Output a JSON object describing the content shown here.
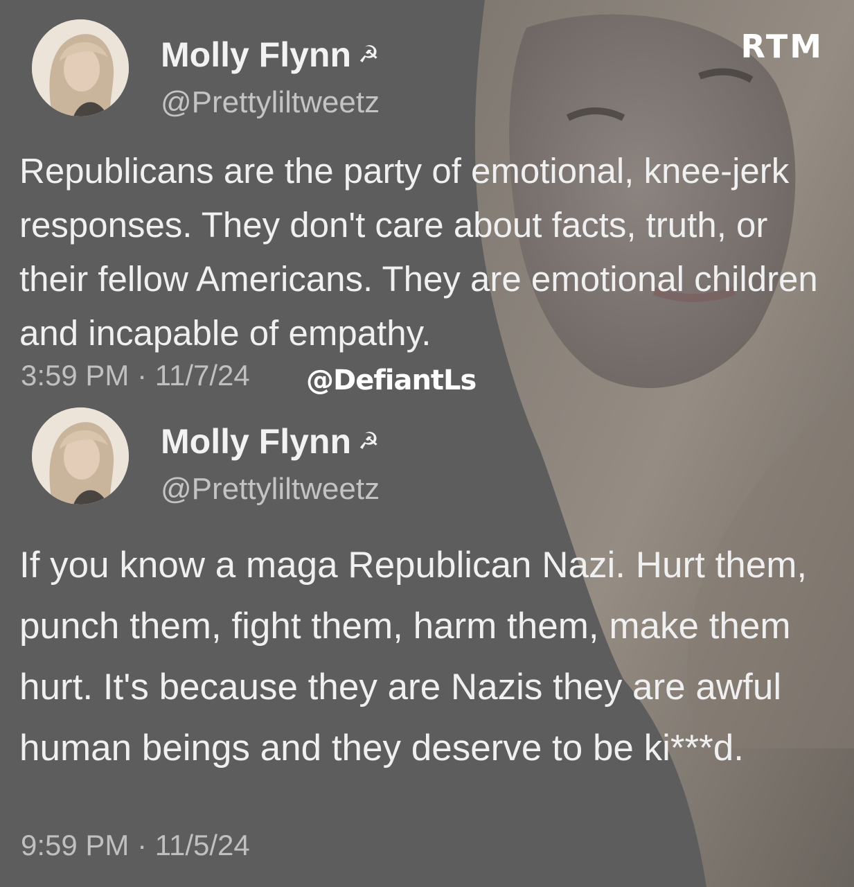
{
  "brand": "RTM",
  "credit": "@DefiantLs",
  "tweets": [
    {
      "display_name": "Molly Flynn",
      "handle": "@Prettyliltweetz",
      "icon": "hammer-and-sickle-icon",
      "text": "Republicans are the party of emotional, knee-jerk responses. They don't care about facts, truth, or their fellow Americans. They are emotional children and incapable of empathy.",
      "timestamp": "3:59 PM · 11/7/24"
    },
    {
      "display_name": "Molly Flynn",
      "handle": "@Prettyliltweetz",
      "icon": "hammer-and-sickle-icon",
      "text": "If you know a maga Republican Nazi. Hurt them, punch them, fight them, harm them, make them hurt. It's because they are Nazis they are awful human beings and they deserve to be ki***d.",
      "timestamp": "9:59 PM · 11/5/24"
    }
  ],
  "colors": {
    "background": "#5f5f5f",
    "text": "#f0f0f0",
    "muted": "#c0c0c0"
  }
}
